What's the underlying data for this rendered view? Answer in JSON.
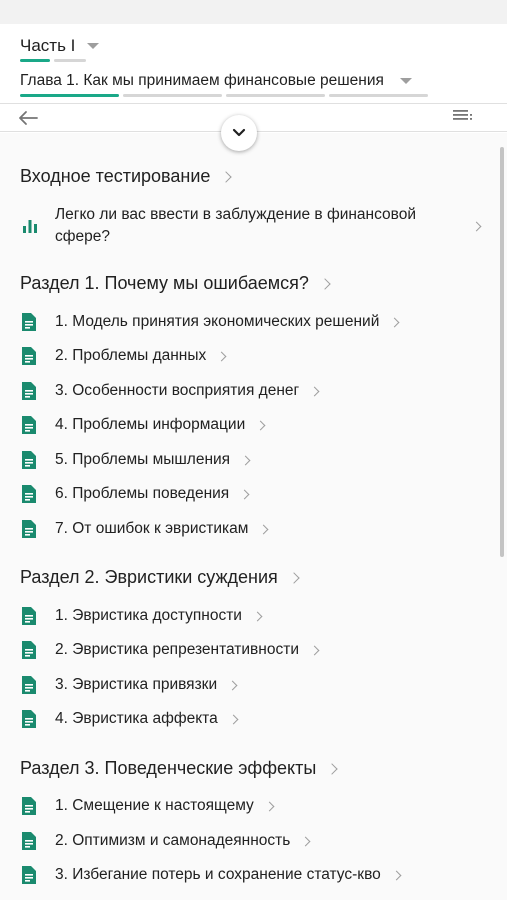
{
  "colors": {
    "accent": "#1aa888",
    "icon": "#1a8a6e",
    "indicator_inactive": "#d6d6d6"
  },
  "header": {
    "part_title": "Часть I",
    "chapter_title": "Глава 1. Как мы принимаем финансовые решения"
  },
  "toolbar": {
    "back_icon": "arrow-left-icon",
    "collapse_icon": "chevron-down-icon",
    "menu_icon": "list-menu-icon"
  },
  "sections": [
    {
      "title": "Входное тестирование",
      "items": [
        {
          "label": "Легко ли вас ввести в заблуждение в финансовой сфере?",
          "icon": "bar-chart-icon"
        }
      ]
    },
    {
      "title": "Раздел 1.  Почему мы ошибаемся?",
      "items": [
        {
          "label": "1. Модель принятия экономических решений",
          "icon": "document-icon"
        },
        {
          "label": "2. Проблемы данных",
          "icon": "document-icon"
        },
        {
          "label": "3. Особенности восприятия денег",
          "icon": "document-icon"
        },
        {
          "label": "4. Проблемы информации",
          "icon": "document-icon"
        },
        {
          "label": "5. Проблемы мышления",
          "icon": "document-icon"
        },
        {
          "label": "6. Проблемы поведения",
          "icon": "document-icon"
        },
        {
          "label": "7. От ошибок к эвристикам",
          "icon": "document-icon"
        }
      ]
    },
    {
      "title": "Раздел 2. Эвристики  суждения",
      "items": [
        {
          "label": "1. Эвристика доступности",
          "icon": "document-icon"
        },
        {
          "label": "2. Эвристика репрезентативности",
          "icon": "document-icon"
        },
        {
          "label": "3. Эвристика привязки",
          "icon": "document-icon"
        },
        {
          "label": "4. Эвристика аффекта",
          "icon": "document-icon"
        }
      ]
    },
    {
      "title": "Раздел 3. Поведенческие эффекты",
      "items": [
        {
          "label": "1. Смещение к настоящему",
          "icon": "document-icon"
        },
        {
          "label": "2. Оптимизм и самонадеянность",
          "icon": "document-icon"
        },
        {
          "label": "3. Избегание потерь и сохранение статус-кво",
          "icon": "document-icon"
        }
      ]
    }
  ]
}
